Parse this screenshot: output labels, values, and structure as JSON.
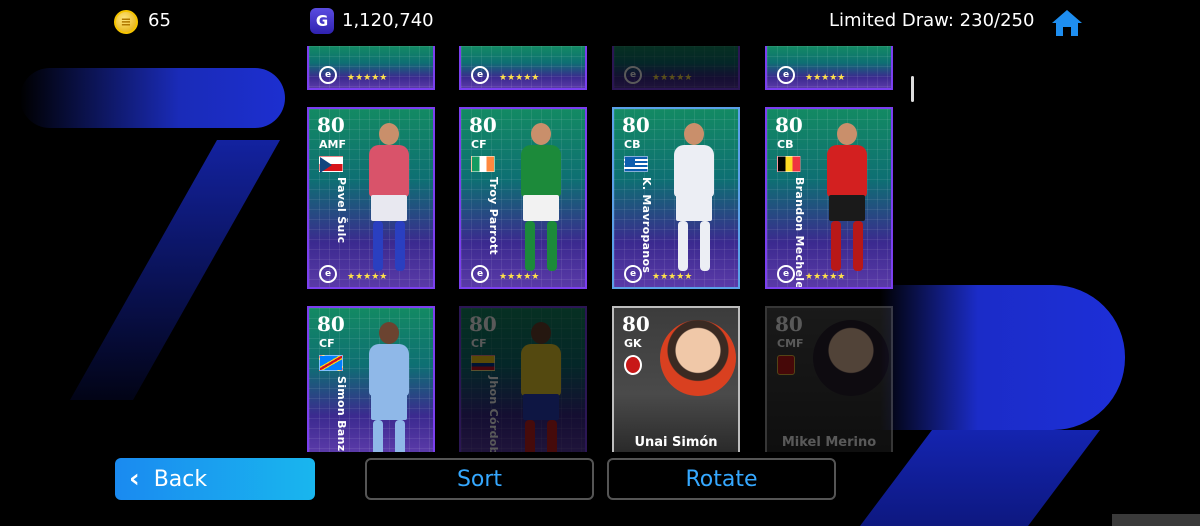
{
  "header": {
    "coins_value": "65",
    "gp_icon_letter": "G",
    "gp_value": "1,120,740",
    "limited_draw": "Limited Draw: 230/250"
  },
  "top_row_stars": [
    "★★★★★",
    "★★★★★",
    "★★★★★",
    "★★★★★"
  ],
  "row1": [
    {
      "rating": "80",
      "position": "AMF",
      "name": "Pavel Šulc",
      "stars": "★★★★★",
      "flag": "czech"
    },
    {
      "rating": "80",
      "position": "CF",
      "name": "Troy Parrott",
      "stars": "★★★★★",
      "flag": "ireland"
    },
    {
      "rating": "80",
      "position": "CB",
      "name": "K. Mavropanos",
      "stars": "★★★★★",
      "flag": "greece"
    },
    {
      "rating": "80",
      "position": "CB",
      "name": "Brandon Mechele",
      "stars": "★★★★★",
      "flag": "belgium"
    }
  ],
  "row2": [
    {
      "rating": "80",
      "position": "CF",
      "name": "Simon Banza",
      "flag": "dr-congo"
    },
    {
      "rating": "80",
      "position": "CF",
      "name": "Jhon Córdoba",
      "flag": "colombia"
    },
    {
      "rating": "80",
      "position": "GK",
      "name": "Unai Simón"
    },
    {
      "rating": "80",
      "position": "CMF",
      "name": "Mikel Merino"
    }
  ],
  "buttons": {
    "back": "Back",
    "sort": "Sort",
    "rotate": "Rotate"
  },
  "colors": {
    "card_frame": "#7b3ff0",
    "accent_blue": "#35a8ff",
    "back_button": "#1a8af0"
  }
}
